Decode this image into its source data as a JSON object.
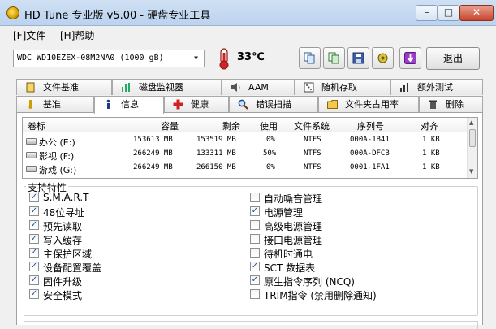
{
  "window": {
    "title": "HD Tune 专业版 v5.00 - 硬盘专业工具",
    "minimize_glyph": "–",
    "maximize_glyph": "□",
    "close_glyph": "✕"
  },
  "menu": [
    {
      "label": "[F]文件"
    },
    {
      "label": "[H]帮助"
    }
  ],
  "toolbar": {
    "drive": "WDC WD10EZEX-08M2NA0 (1000 gB)",
    "temperature": "33℃",
    "exit_label": "退出",
    "icons": [
      "copy-icon",
      "copy-screen-icon",
      "save-icon",
      "options-icon",
      "download-icon"
    ]
  },
  "tabs_row1": [
    {
      "label": "文件基准",
      "icon": "file-benchmark-icon"
    },
    {
      "label": "磁盘监视器",
      "icon": "disk-monitor-icon"
    },
    {
      "label": "AAM",
      "icon": "speaker-icon"
    },
    {
      "label": "随机存取",
      "icon": "random-access-icon"
    },
    {
      "label": "额外测试",
      "icon": "extra-tests-icon"
    }
  ],
  "tabs_row2": [
    {
      "label": "基准",
      "icon": "benchmark-icon"
    },
    {
      "label": "信息",
      "icon": "info-icon",
      "active": true
    },
    {
      "label": "健康",
      "icon": "health-icon"
    },
    {
      "label": "错误扫描",
      "icon": "error-scan-icon"
    },
    {
      "label": "文件夹占用率",
      "icon": "folder-usage-icon"
    },
    {
      "label": "删除",
      "icon": "erase-icon"
    }
  ],
  "volumes": {
    "headers": [
      "卷标",
      "容量",
      "剩余",
      "使用",
      "文件系统",
      "序列号",
      "对齐"
    ],
    "rows": [
      [
        "办公 (E:)",
        "153613 MB",
        "153519 MB",
        "0%",
        "NTFS",
        "000A-1B41",
        "1 KB"
      ],
      [
        "影视 (F:)",
        "266249 MB",
        "133311 MB",
        "50%",
        "NTFS",
        "000A-DFCB",
        "1 KB"
      ],
      [
        "游戏 (G:)",
        "266249 MB",
        "266150 MB",
        "0%",
        "NTFS",
        "0001-1FA1",
        "1 KB"
      ]
    ]
  },
  "features": {
    "title": "支持特性",
    "left": [
      {
        "label": "S.M.A.R.T",
        "checked": true
      },
      {
        "label": "48位寻址",
        "checked": true
      },
      {
        "label": "预先读取",
        "checked": true
      },
      {
        "label": "写入缓存",
        "checked": true
      },
      {
        "label": "主保护区域",
        "checked": true
      },
      {
        "label": "设备配置覆盖",
        "checked": true
      },
      {
        "label": "固件升级",
        "checked": true
      },
      {
        "label": "安全模式",
        "checked": true
      }
    ],
    "right": [
      {
        "label": "自动噪音管理",
        "checked": false
      },
      {
        "label": "电源管理",
        "checked": true
      },
      {
        "label": "高级电源管理",
        "checked": false
      },
      {
        "label": "接口电源管理",
        "checked": false
      },
      {
        "label": "待机时通电",
        "checked": false
      },
      {
        "label": "SCT 数据表",
        "checked": true
      },
      {
        "label": "原生指令序列 (NCQ)",
        "checked": true
      },
      {
        "label": "TRIM指令 (禁用删除通知)",
        "checked": false
      }
    ]
  }
}
